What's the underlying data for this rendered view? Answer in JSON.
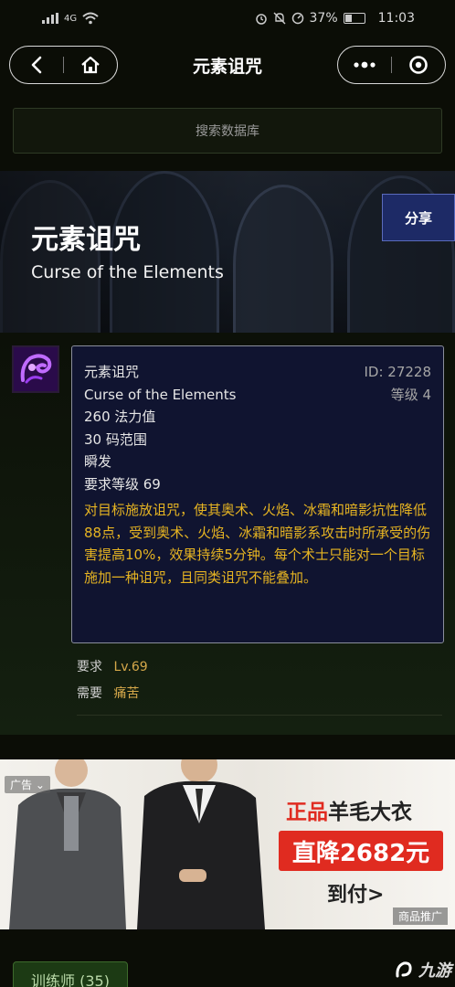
{
  "status_bar": {
    "signal": "4G",
    "battery": "37%",
    "time": "11:03"
  },
  "header": {
    "title": "元素诅咒"
  },
  "search": {
    "placeholder": "搜索数据库"
  },
  "banner": {
    "title_cn": "元素诅咒",
    "title_en": "Curse of the Elements",
    "share_label": "分享"
  },
  "tooltip": {
    "name_cn": "元素诅咒",
    "id": "ID: 27228",
    "name_en": "Curse of the Elements",
    "rank": "等级 4",
    "mana": "260 法力值",
    "range": "30 码范围",
    "cast": "瞬发",
    "level_req": "要求等级 69",
    "description": "对目标施放诅咒，使其奥术、火焰、冰霜和暗影抗性降低88点，受到奥术、火焰、冰霜和暗影系攻击时所承受的伤害提高10%，效果持续5分钟。每个术士只能对一个目标施加一种诅咒，且同类诅咒不能叠加。"
  },
  "requirements": {
    "req_label": "要求",
    "req_value": "Lv.69",
    "need_label": "需要",
    "need_value": "痛苦"
  },
  "ad": {
    "tag": "广告",
    "line1_red": "正品",
    "line1_black": "羊毛大衣",
    "line2": "直降2682元",
    "line3": "到付>",
    "label": "商品推广"
  },
  "bottom": {
    "trainer": "训练师 (35)"
  },
  "watermark": "九游",
  "colors": {
    "background": "#0b0d06",
    "tooltip_bg": "#101430",
    "gold": "#e6b422",
    "share_bg": "#1d2a66",
    "ad_red": "#e02b20"
  }
}
